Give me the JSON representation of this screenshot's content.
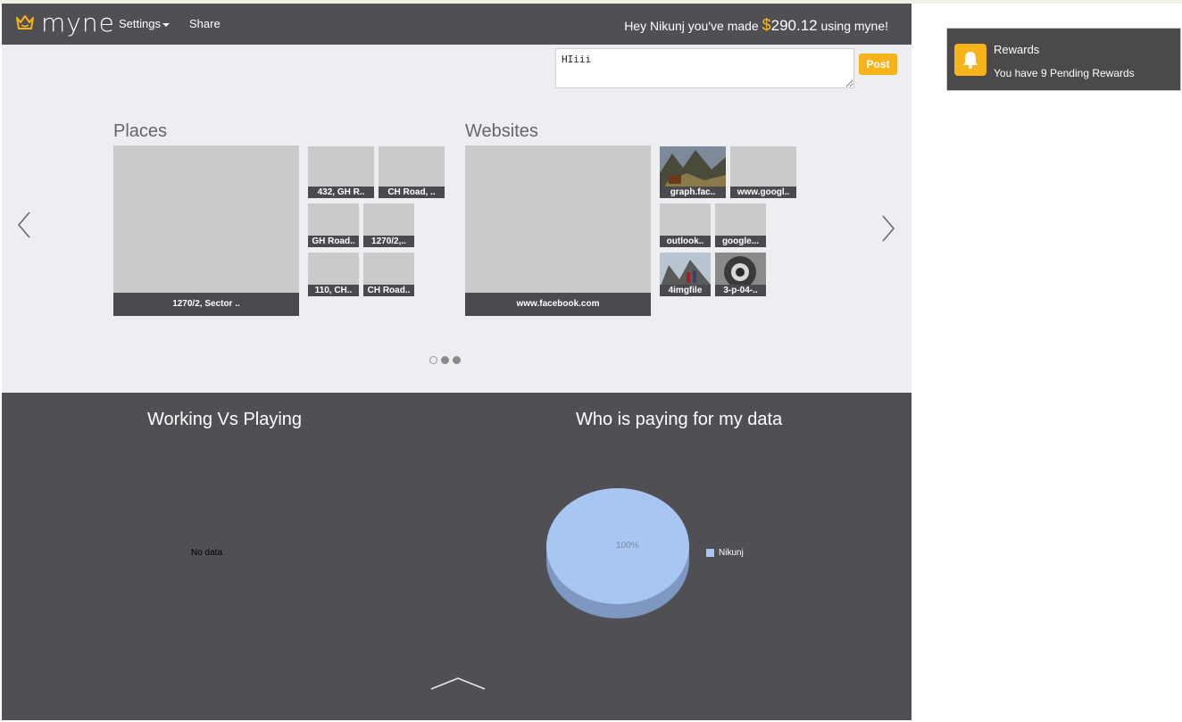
{
  "app": {
    "logo_text": "myne",
    "nav": {
      "settings_label": "Settings",
      "share_label": "Share"
    },
    "earnings": {
      "prefix": "Hey Nikunj you've made ",
      "currency": "$",
      "amount": "290.12",
      "suffix": " using myne!"
    }
  },
  "post": {
    "value": "HIiii",
    "button_label": "Post"
  },
  "places": {
    "title": "Places",
    "tiles": [
      {
        "label": "1270/2, Sector .."
      },
      {
        "label": "432, GH R.."
      },
      {
        "label": "CH Road, .."
      },
      {
        "label": "GH Road.."
      },
      {
        "label": "1270/2,.."
      },
      {
        "label": "110, CH.."
      },
      {
        "label": "CH Road.."
      }
    ]
  },
  "websites": {
    "title": "Websites",
    "tiles": [
      {
        "label": "www.facebook.com"
      },
      {
        "label": "graph.fac.."
      },
      {
        "label": "www.googl.."
      },
      {
        "label": "outlook.."
      },
      {
        "label": "google..."
      },
      {
        "label": "4imgfile"
      },
      {
        "label": "3-p-04-.."
      }
    ]
  },
  "charts": {
    "working_title": "Working Vs Playing",
    "working_empty": "No data",
    "paying_title": "Who is paying for my data"
  },
  "chart_data": {
    "type": "pie",
    "title": "Who is paying for my data",
    "slices": [
      {
        "label": "Nikunj",
        "value": 100
      }
    ],
    "slice_label": "100%",
    "legend": "right",
    "colors": {
      "Nikunj": "#a7c6f2"
    }
  },
  "notification": {
    "title": "Rewards",
    "body": "You have 9 Pending Rewards",
    "icon": "bell-icon"
  },
  "colors": {
    "accent": "#f8b31b",
    "dark": "#504f54",
    "panel": "#eceef2",
    "tile": "#cacaca"
  }
}
